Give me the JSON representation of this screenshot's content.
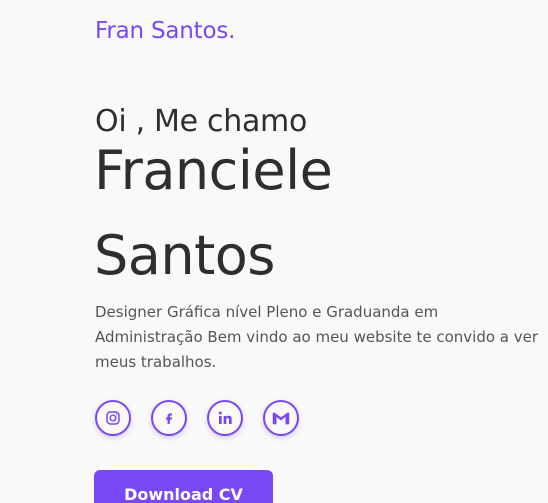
{
  "header": {
    "brand": "Fran Santos."
  },
  "hero": {
    "greeting": "Oi , Me chamo",
    "first_name": "Franciele",
    "last_name": "Santos",
    "bio": "Designer Gráfica nível Pleno e Graduanda em Administração Bem vindo ao meu website te convido a ver meus trabalhos."
  },
  "socials": [
    {
      "icon": "instagram-icon"
    },
    {
      "icon": "facebook-icon"
    },
    {
      "icon": "linkedin-icon"
    },
    {
      "icon": "gmail-icon"
    }
  ],
  "cta": {
    "label": "Download CV"
  },
  "colors": {
    "accent": "#7848f4",
    "background": "#f9f9f9",
    "text": "#2e2e2e"
  }
}
